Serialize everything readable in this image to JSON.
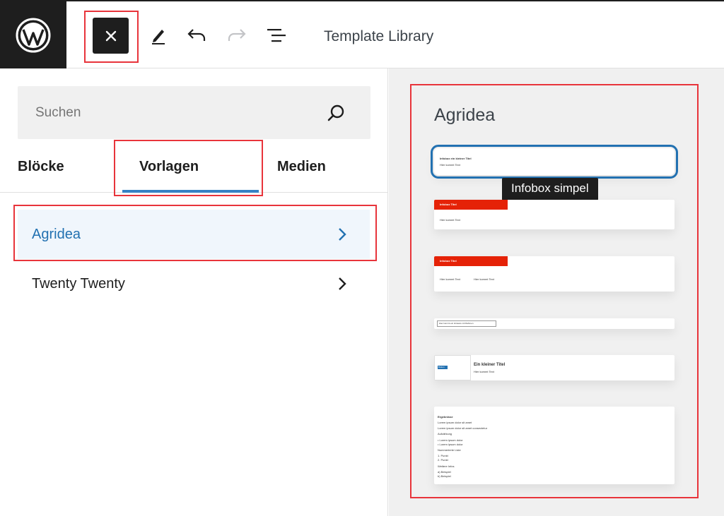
{
  "toolbar": {
    "title": "Template Library",
    "logo_icon": "wordpress-logo-icon",
    "close_icon": "close-icon",
    "edit_icon": "pencil-icon",
    "undo_icon": "undo-icon",
    "redo_icon": "redo-icon",
    "outline_icon": "list-view-icon"
  },
  "search": {
    "placeholder": "Suchen",
    "icon": "search-icon"
  },
  "tabs": [
    {
      "label": "Blöcke"
    },
    {
      "label": "Vorlagen",
      "active": true
    },
    {
      "label": "Medien"
    }
  ],
  "categories": [
    {
      "label": "Agridea",
      "active": true
    },
    {
      "label": "Twenty Twenty"
    }
  ],
  "preview": {
    "category_title": "Agridea",
    "tooltip": "Infobox simpel",
    "card1": {
      "title": "Infobox ein kleiner Titel",
      "text": "Hier kommt Text"
    },
    "card2": {
      "title": "Infobox Titel",
      "text": "Hier kommt Text"
    },
    "card3": {
      "title": "Infobox Titel",
      "text_a": "Hier kommt Text",
      "text_b": "Hier kommt Text"
    },
    "card4": {
      "text": "Hier kommt ein Hinweis mit Rahmen"
    },
    "card5": {
      "title": "Ein kleiner Titel",
      "text": "Hier kommt Text",
      "button": "Button"
    },
    "card6": {
      "heading": "Ergebnisse",
      "lines": [
        "Lorem ipsum dolor sit amet",
        "Lorem ipsum dolor sit amet consectetur",
        "Aufzählung",
        "• Lorem ipsum dolor",
        "• Lorem ipsum dolor",
        "Nummerierte Liste",
        "1. Punkt",
        "2. Punkt",
        "Weitere Infos",
        "a) Beispiel",
        "b) Beispiel"
      ]
    }
  },
  "colors": {
    "accent": "#2271b1",
    "highlight": "#e8343b",
    "infobox_red": "#e52207",
    "toolbar_dark": "#1e1e1e"
  }
}
